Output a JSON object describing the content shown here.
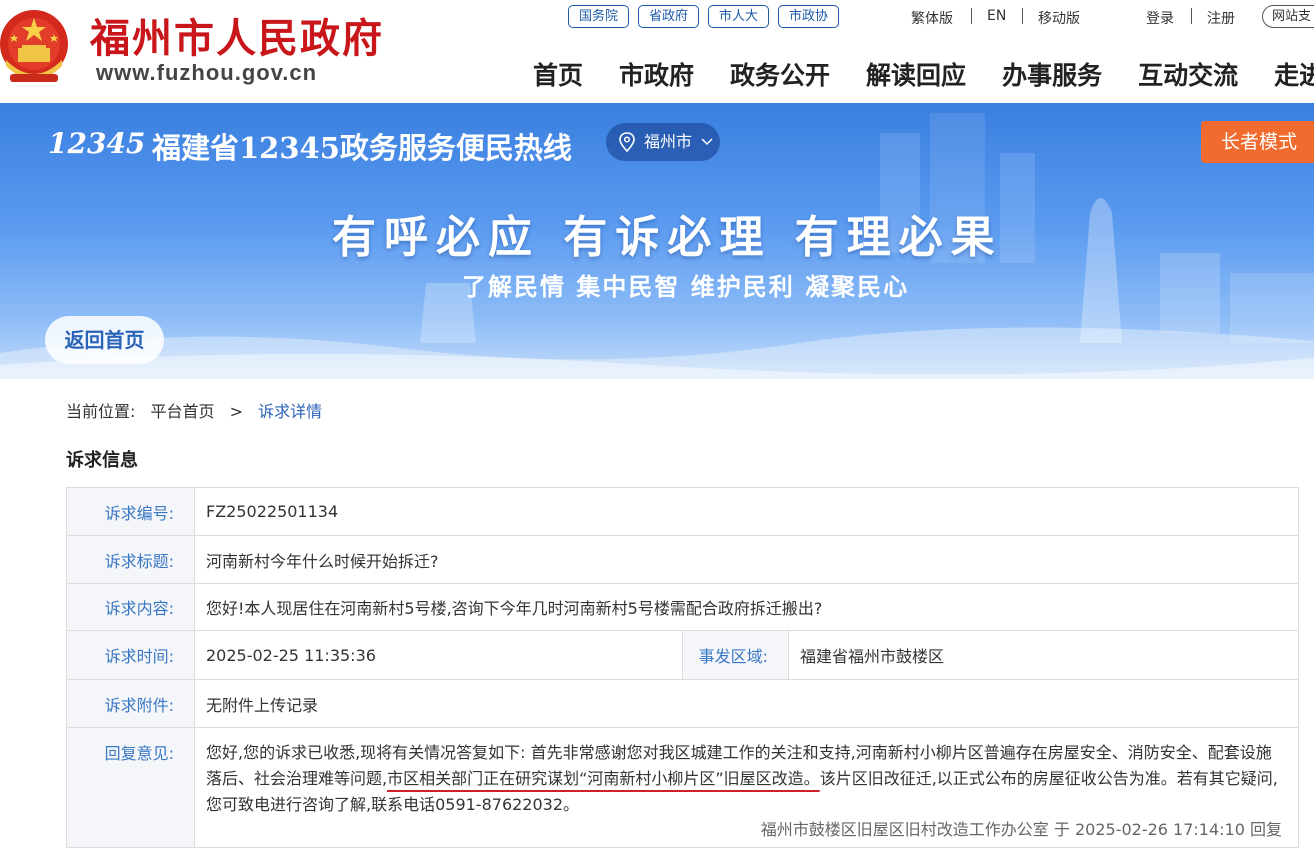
{
  "header": {
    "site_title": "福州市人民政府",
    "site_url": "www.fuzhou.gov.cn",
    "gov_links": [
      "国务院",
      "省政府",
      "市人大",
      "市政协"
    ],
    "utility": {
      "traditional": "繁体版",
      "english": "EN",
      "mobile": "移动版",
      "login": "登录",
      "register": "注册",
      "help": "网站支"
    },
    "nav": [
      "首页",
      "市政府",
      "政务公开",
      "解读回应",
      "办事服务",
      "互动交流",
      "走进"
    ]
  },
  "banner": {
    "hotline_logo": "12345",
    "hotline_title": "福建省12345政务服务便民热线",
    "city": "福州市",
    "elder_mode": "长者模式",
    "slogan_main": "有呼必应  有诉必理  有理必果",
    "slogan_sub": "了解民情 集中民智 维护民利 凝聚民心",
    "back_home": "返回首页"
  },
  "breadcrumb": {
    "label": "当前位置:",
    "home": "平台首页",
    "separator": ">",
    "current": "诉求详情"
  },
  "section_title": "诉求信息",
  "appeal": {
    "id_label": "诉求编号:",
    "id": "FZ25022501134",
    "title_label": "诉求标题:",
    "title": "河南新村今年什么时候开始拆迁?",
    "content_label": "诉求内容:",
    "content": "您好!本人现居住在河南新村5号楼,咨询下今年几时河南新村5号楼需配合政府拆迁搬出?",
    "time_label": "诉求时间:",
    "time": "2025-02-25 11:35:36",
    "region_label": "事发区域:",
    "region": "福建省福州市鼓楼区",
    "attach_label": "诉求附件:",
    "attach": "无附件上传记录",
    "reply_label": "回复意见:",
    "reply_part1": "您好,您的诉求已收悉,现将有关情况答复如下: 首先非常感谢您对我区城建工作的关注和支持,河南新村小柳片区普遍存在房屋安全、消防安全、配套设施落后、社会治理难等问题,",
    "reply_highlight": "市区相关部门正在研究谋划“河南新村小柳片区”旧屋区改造。",
    "reply_part2": "该片区旧改征迁,以正式公布的房屋征收公告为准。若有其它疑问,您可致电进行咨询了解,联系电话0591-87622032。",
    "reply_sign": "福州市鼓楼区旧屋区旧村改造工作办公室 于 2025-02-26 17:14:10 回复"
  },
  "colors": {
    "brand_red": "#c9161a",
    "link_blue": "#1e5aa8",
    "label_blue": "#3a78c4",
    "elder_orange": "#f06b2d",
    "banner_blue": "#3a7fe0"
  }
}
